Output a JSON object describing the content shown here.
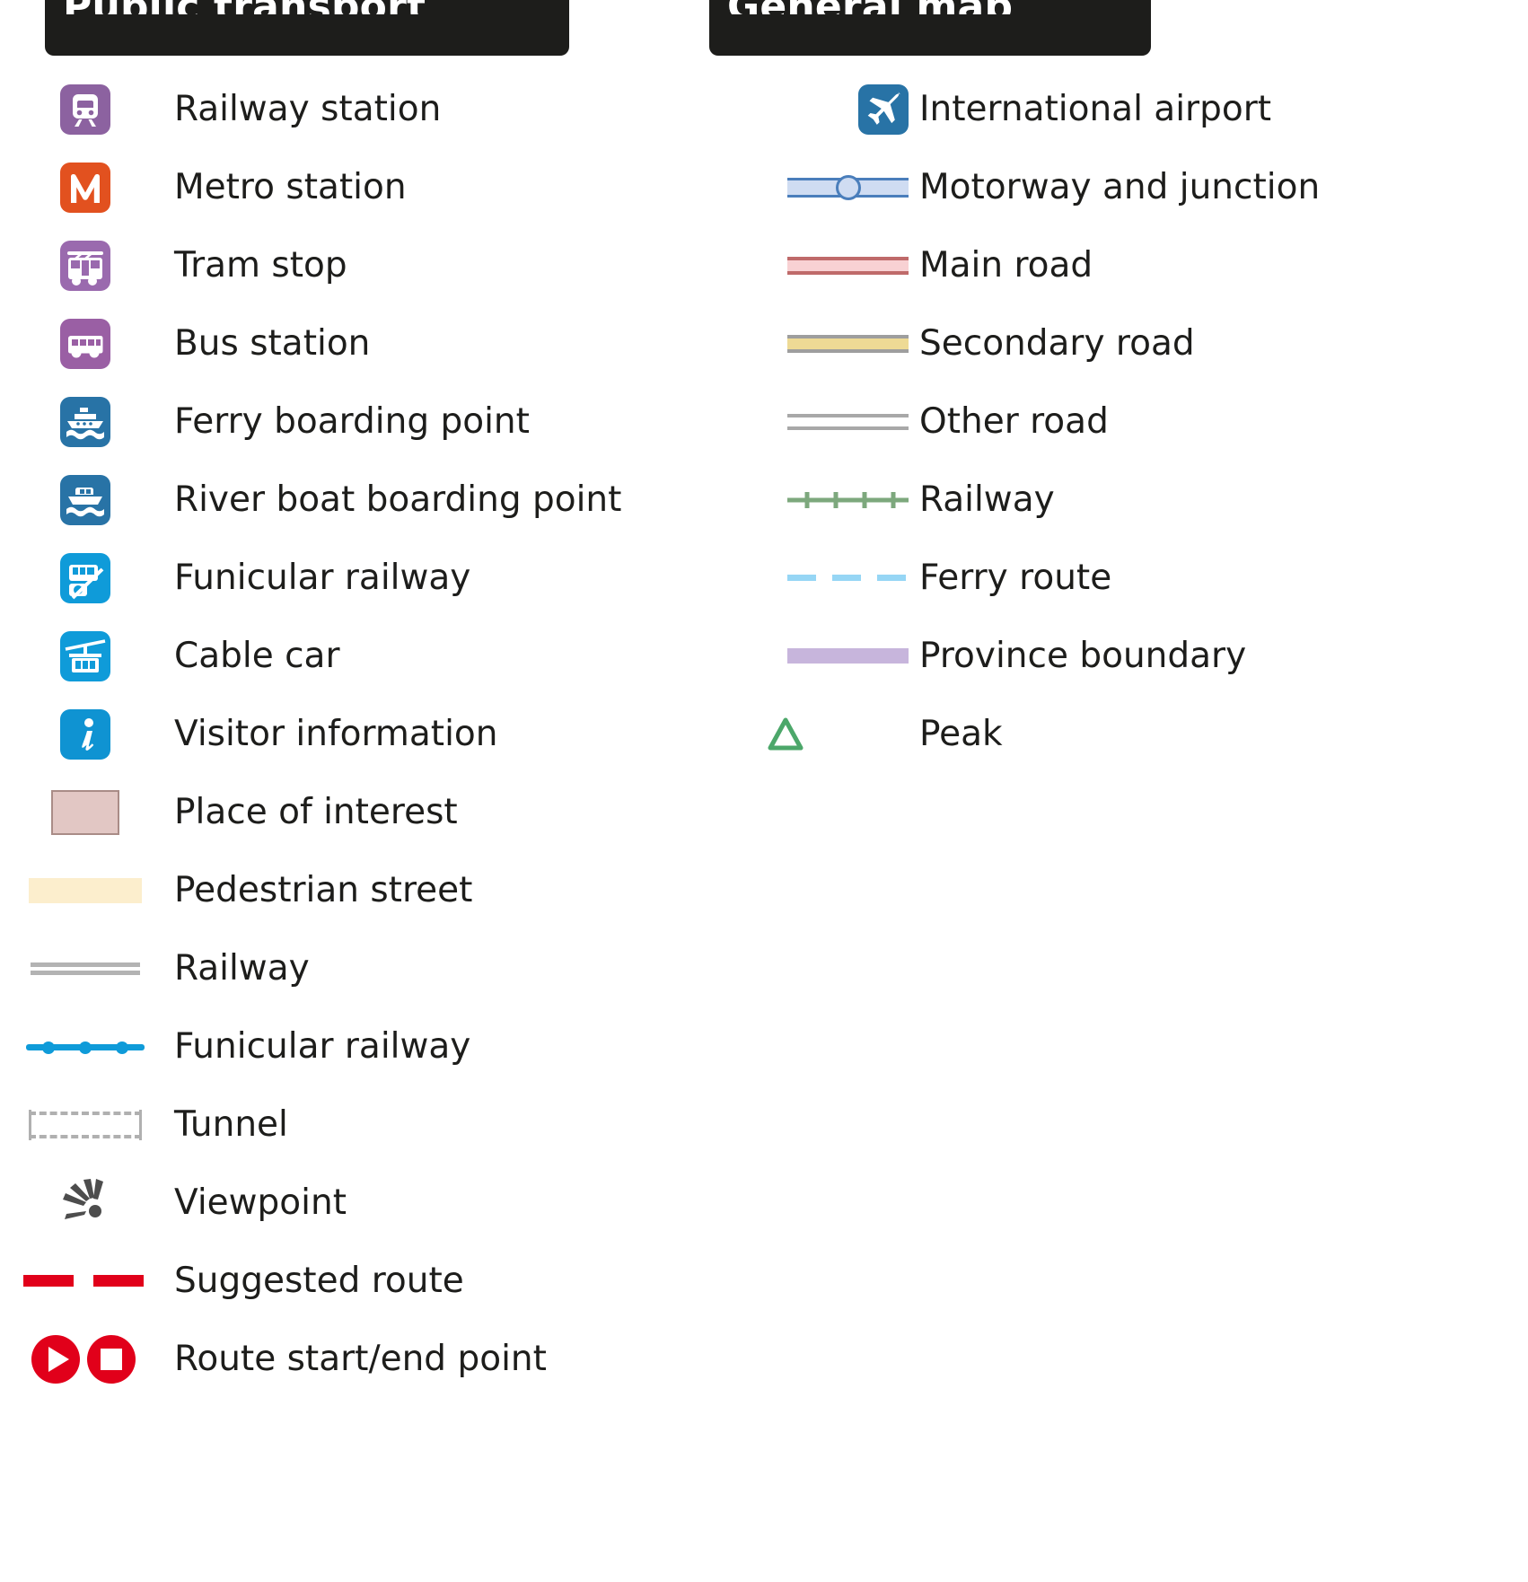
{
  "meta": {
    "doc_type": "map-legend",
    "background": "#ffffff"
  },
  "colors": {
    "rail_purple": "#8c62a0",
    "metro_orange": "#e2511f",
    "tram_purple": "#9a6aae",
    "bus_purple": "#9a5fa4",
    "ferry_blue": "#2873a6",
    "funicular_blue": "#0f9bd9",
    "info_blue": "#0f93d2",
    "airport_blue": "#2873a6",
    "poi_fill": "#e2c7c4",
    "poi_stroke": "#a98c87",
    "pedestrian_fill": "#fceecd",
    "railway_grey": "#b3b3b3",
    "tunnel_grey": "#b0b0b0",
    "viewpoint_grey": "#4d4d4d",
    "route_red": "#e1001a",
    "motorway_fill": "#cfdcf2",
    "motorway_stroke": "#4a7ebb",
    "main_road_fill": "#f8d1d3",
    "main_road_stroke": "#bf6a6a",
    "secondary_fill": "#eeda95",
    "secondary_stroke": "#9e9e9e",
    "other_road_fill": "#ffffff",
    "other_road_stroke": "#a8a8a8",
    "railway_green": "#7da87d",
    "ferry_route_blue": "#96d6f5",
    "province_purple": "#c7b5dc",
    "peak_green": "#4ca76a",
    "banner_black": "#1d1d1b",
    "text_black": "#1d1d1b"
  },
  "left_column": {
    "header": "Public transport",
    "items": [
      {
        "icon": "railway-station-icon",
        "label": "Railway station"
      },
      {
        "icon": "metro-station-icon",
        "label": "Metro station"
      },
      {
        "icon": "tram-stop-icon",
        "label": "Tram stop"
      },
      {
        "icon": "bus-station-icon",
        "label": "Bus station"
      },
      {
        "icon": "ferry-boarding-point-icon",
        "label": "Ferry boarding point"
      },
      {
        "icon": "river-boat-boarding-point-icon",
        "label": "River boat boarding point"
      },
      {
        "icon": "funicular-railway-icon",
        "label": "Funicular railway"
      },
      {
        "icon": "cable-car-icon",
        "label": "Cable car"
      },
      {
        "icon": "visitor-information-icon",
        "label": "Visitor information"
      },
      {
        "icon": "place-of-interest-swatch",
        "label": "Place of interest"
      },
      {
        "icon": "pedestrian-street-swatch",
        "label": "Pedestrian street"
      },
      {
        "icon": "railway-line-symbol",
        "label": "Railway"
      },
      {
        "icon": "funicular-railway-line-symbol",
        "label": "Funicular railway"
      },
      {
        "icon": "tunnel-line-symbol",
        "label": "Tunnel"
      },
      {
        "icon": "viewpoint-icon",
        "label": "Viewpoint"
      },
      {
        "icon": "suggested-route-line-symbol",
        "label": "Suggested route"
      },
      {
        "icon": "route-start-end-point-icon",
        "label": "Route start/end point"
      }
    ]
  },
  "right_column": {
    "header": "General map",
    "items": [
      {
        "icon": "international-airport-icon",
        "label": "International airport"
      },
      {
        "icon": "motorway-junction-line-symbol",
        "label": "Motorway and junction"
      },
      {
        "icon": "main-road-line-symbol",
        "label": "Main road"
      },
      {
        "icon": "secondary-road-line-symbol",
        "label": "Secondary road"
      },
      {
        "icon": "other-road-line-symbol",
        "label": "Other road"
      },
      {
        "icon": "railway-line-symbol",
        "label": "Railway"
      },
      {
        "icon": "ferry-route-line-symbol",
        "label": "Ferry route"
      },
      {
        "icon": "province-boundary-line-symbol",
        "label": "Province boundary"
      },
      {
        "icon": "peak-icon",
        "label": "Peak"
      }
    ]
  }
}
